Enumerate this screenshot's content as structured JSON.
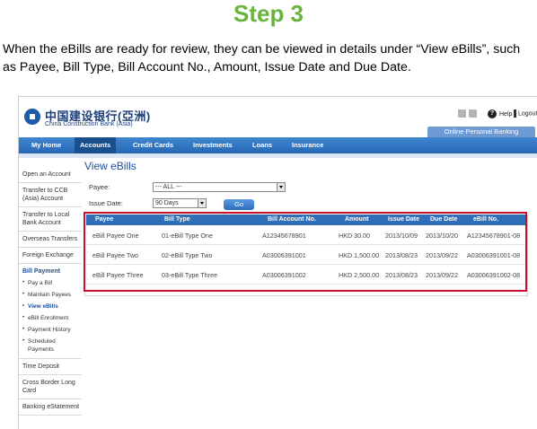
{
  "step_title": "Step 3",
  "intro_text": "When the eBills are ready for review, they can be viewed in details under “View eBills”, such as Payee, Bill Type, Bill Account No., Amount, Issue Date and Due Date.",
  "header": {
    "logo_cn": "中国建设银行(亞洲)",
    "logo_en": "China Construction Bank (Asia)",
    "help_label": "Help",
    "logout_label": "Logout",
    "banner_label": "Online Personal Banking"
  },
  "nav": {
    "items": [
      "My Home",
      "Accounts",
      "Credit Cards",
      "Investments",
      "Loans",
      "Insurance"
    ],
    "active_index": 1
  },
  "sidebar": {
    "items_top": [
      "Open an Account",
      "Transfer to CCB (Asia) Account",
      "Transfer to Local Bank Account",
      "Overseas Transfers",
      "Foreign Exchange"
    ],
    "group_label": "Bill Payment",
    "sub_items": [
      "Pay a Bill",
      "Maintain Payees",
      "View eBills",
      "eBill Enrollment",
      "Payment History",
      "Scheduled Payments"
    ],
    "active_sub_index": 2,
    "items_bottom": [
      "Time Deposit",
      "Cross Border Long Card",
      "Banking eStatement"
    ]
  },
  "main": {
    "title": "View eBills",
    "payee_label": "Payee:",
    "payee_value": "--- ALL ---",
    "issue_date_label": "Issue Date:",
    "issue_date_value": "90 Days",
    "go_label": "Go"
  },
  "table": {
    "columns": [
      "Payee",
      "Bill Type",
      "Bill Account No.",
      "Amount",
      "Issue Date",
      "Due Date",
      "eBill No."
    ],
    "rows": [
      [
        "eBill Payee One",
        "01-eBill Type One",
        "A12345678901",
        "HKD 30.00",
        "2013/10/09",
        "2013/10/20",
        "A12345678901-08"
      ],
      [
        "eBill Payee Two",
        "02-eBill Type Two",
        "A03006391001",
        "HKD 1,500.00",
        "2013/08/23",
        "2013/09/22",
        "A03006391001-08"
      ],
      [
        "eBill Payee Three",
        "03-eBill Type Three",
        "A03006391002",
        "HKD 2,500.00",
        "2013/08/23",
        "2013/09/22",
        "A03006391002-08"
      ]
    ]
  },
  "colors": {
    "step_green": "#6ab43e",
    "nav_blue": "#2f6fb8",
    "highlight_red": "#c8102e"
  }
}
